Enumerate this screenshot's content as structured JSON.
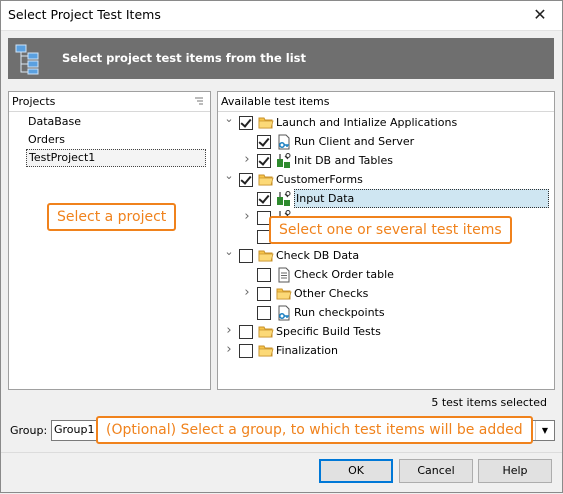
{
  "window": {
    "title": "Select Project Test Items",
    "close_glyph": "✕"
  },
  "banner": {
    "text": "Select project test items from the list",
    "icon": "project-tree-icon"
  },
  "projects": {
    "header": "Projects",
    "items": [
      "DataBase",
      "Orders",
      "TestProject1"
    ],
    "selected": "TestProject1"
  },
  "tests": {
    "header": "Available test items",
    "rows": [
      {
        "label": "Launch and Intialize Applications",
        "checked": true,
        "expanded": true,
        "icon": "folder-icon"
      },
      {
        "label": "Run Client and Server",
        "checked": true,
        "icon": "key-script-icon"
      },
      {
        "label": "Init DB and Tables",
        "checked": true,
        "expanded": false,
        "icon": "keyword-test-icon"
      },
      {
        "label": "CustomerForms",
        "checked": true,
        "expanded": true,
        "icon": "folder-icon"
      },
      {
        "label": "Input Data",
        "checked": true,
        "selected": true,
        "icon": "keyword-test-icon"
      },
      {
        "label": "",
        "checked": false,
        "expanded": false,
        "icon": "keyword-test-icon"
      },
      {
        "label": "",
        "checked": false,
        "icon": "keyword-test-icon"
      },
      {
        "label": "Check DB Data",
        "checked": false,
        "expanded": true,
        "icon": "folder-icon"
      },
      {
        "label": "Check Order table",
        "checked": false,
        "icon": "script-icon"
      },
      {
        "label": "Other Checks",
        "checked": false,
        "expanded": false,
        "icon": "folder-icon"
      },
      {
        "label": "Run checkpoints",
        "checked": false,
        "icon": "key-script-icon"
      },
      {
        "label": "Specific Build Tests",
        "checked": false,
        "expanded": false,
        "icon": "folder-icon"
      },
      {
        "label": "Finalization",
        "checked": false,
        "expanded": false,
        "icon": "folder-icon"
      }
    ]
  },
  "callouts": {
    "project": "Select a project",
    "tests": "Select one or several test items",
    "group": "(Optional) Select a group, to which test items will be added"
  },
  "summary": "5 test items selected",
  "group": {
    "label": "Group:",
    "value": "Group1"
  },
  "buttons": {
    "ok": "OK",
    "cancel": "Cancel",
    "help": "Help"
  },
  "colors": {
    "accent": "#0078d7",
    "callout": "#f0821c",
    "banner": "#6f6f6f",
    "selection": "#cfe6f2"
  }
}
